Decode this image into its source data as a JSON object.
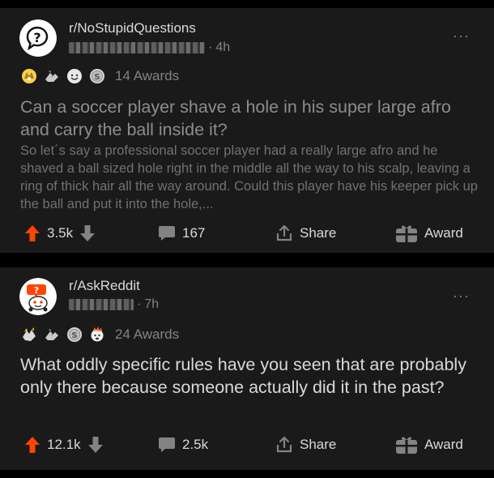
{
  "posts": [
    {
      "subreddit": "r/NoStupidQuestions",
      "username": "u/fr... (redacted)",
      "age": "4h",
      "awards_label": "14 Awards",
      "title": "Can a soccer player shave a hole in his super large afro and carry the ball inside it?",
      "body": "So let´s say a professional soccer player had a really large afro and he shaved a ball sized hole right in the middle all the way to his scalp, leaving a ring of thick hair all the way around. Could this player have his keeper pick up the ball and put it into the hole,...",
      "votes": "3.5k",
      "comments": "167",
      "share_label": "Share",
      "award_label": "Award"
    },
    {
      "subreddit": "r/AskReddit",
      "username": "u/... (redacted)",
      "age": "7h",
      "awards_label": "24 Awards",
      "title": "What oddly specific rules have you seen that are probably only there because someone actually did it in the past?",
      "votes": "12.1k",
      "comments": "2.5k",
      "share_label": "Share",
      "award_label": "Award"
    }
  ],
  "more_glyph": "···",
  "colors": {
    "background": "#000000",
    "card": "#1a1a1b",
    "upvote": "#ff4500",
    "text": "#d7dadc",
    "muted": "#818384"
  },
  "icons": {
    "upvote": "arrow-up-icon",
    "downvote": "arrow-down-icon",
    "comments": "speech-bubble-icon",
    "share": "share-icon",
    "award": "gift-icon"
  }
}
